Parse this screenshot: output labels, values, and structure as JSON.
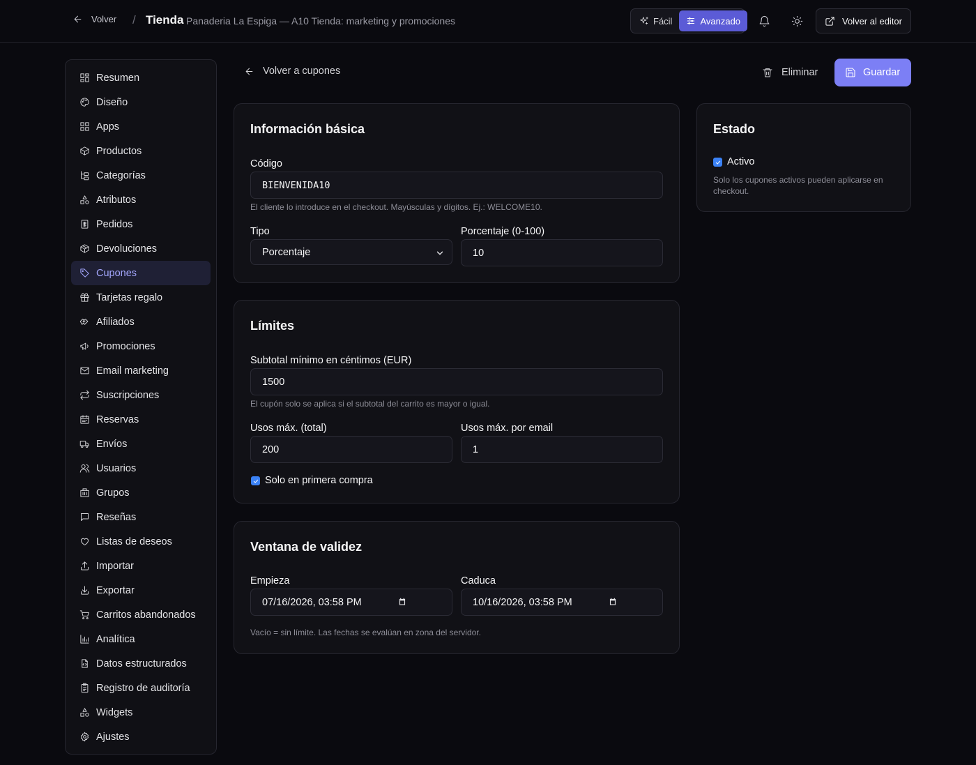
{
  "header": {
    "back_label": "Volver",
    "separator": "/",
    "title": "Tienda",
    "subtitle": "Panaderia La Espiga — A10 Tienda: marketing y promociones",
    "mode_easy": "Fácil",
    "mode_advanced": "Avanzado",
    "editor_label": "Volver al editor"
  },
  "sidebar": {
    "items": [
      {
        "label": "Resumen",
        "icon": "grid-icon"
      },
      {
        "label": "Diseño",
        "icon": "palette-icon"
      },
      {
        "label": "Apps",
        "icon": "apps-icon"
      },
      {
        "label": "Productos",
        "icon": "box-icon"
      },
      {
        "label": "Categorías",
        "icon": "tree-icon"
      },
      {
        "label": "Atributos",
        "icon": "shapes-icon"
      },
      {
        "label": "Pedidos",
        "icon": "receipt-icon"
      },
      {
        "label": "Devoluciones",
        "icon": "package-icon"
      },
      {
        "label": "Cupones",
        "icon": "tag-icon",
        "active": true
      },
      {
        "label": "Tarjetas regalo",
        "icon": "gift-icon"
      },
      {
        "label": "Afiliados",
        "icon": "handshake-icon"
      },
      {
        "label": "Promociones",
        "icon": "megaphone-icon"
      },
      {
        "label": "Email marketing",
        "icon": "mail-icon"
      },
      {
        "label": "Suscripciones",
        "icon": "repeat-icon"
      },
      {
        "label": "Reservas",
        "icon": "calendar-icon"
      },
      {
        "label": "Envíos",
        "icon": "truck-icon"
      },
      {
        "label": "Usuarios",
        "icon": "users-icon"
      },
      {
        "label": "Grupos",
        "icon": "building-icon"
      },
      {
        "label": "Reseñas",
        "icon": "message-icon"
      },
      {
        "label": "Listas de deseos",
        "icon": "heart-icon"
      },
      {
        "label": "Importar",
        "icon": "upload-icon"
      },
      {
        "label": "Exportar",
        "icon": "download-icon"
      },
      {
        "label": "Carritos abandonados",
        "icon": "cart-icon"
      },
      {
        "label": "Analítica",
        "icon": "chart-icon"
      },
      {
        "label": "Datos estructurados",
        "icon": "file-code-icon"
      },
      {
        "label": "Registro de auditoría",
        "icon": "clipboard-icon"
      },
      {
        "label": "Widgets",
        "icon": "shapes-icon"
      },
      {
        "label": "Ajustes",
        "icon": "gear-icon"
      }
    ]
  },
  "main": {
    "back_label": "Volver a cupones",
    "delete_label": "Eliminar",
    "save_label": "Guardar"
  },
  "basic": {
    "title": "Información básica",
    "code_label": "Código",
    "code_value": "BIENVENIDA10",
    "code_hint": "El cliente lo introduce en el checkout. Mayúsculas y dígitos. Ej.: WELCOME10.",
    "type_label": "Tipo",
    "type_value": "Porcentaje",
    "percent_label": "Porcentaje (0-100)",
    "percent_value": "10"
  },
  "limits": {
    "title": "Límites",
    "subtotal_label": "Subtotal mínimo en céntimos (EUR)",
    "subtotal_value": "1500",
    "subtotal_hint": "El cupón solo se aplica si el subtotal del carrito es mayor o igual.",
    "max_total_label": "Usos máx. (total)",
    "max_total_value": "200",
    "max_email_label": "Usos máx. por email",
    "max_email_value": "1",
    "first_purchase_label": "Solo en primera compra",
    "first_purchase_checked": true
  },
  "validity": {
    "title": "Ventana de validez",
    "start_label": "Empieza",
    "start_value": "07/16/2026, 03:58 PM",
    "end_label": "Caduca",
    "end_value": "10/16/2026, 03:58 PM",
    "hint": "Vacío = sin límite. Las fechas se evalúan en zona del servidor."
  },
  "status": {
    "title": "Estado",
    "active_label": "Activo",
    "active_checked": true,
    "hint": "Solo los cupones activos pueden aplicarse en checkout."
  }
}
